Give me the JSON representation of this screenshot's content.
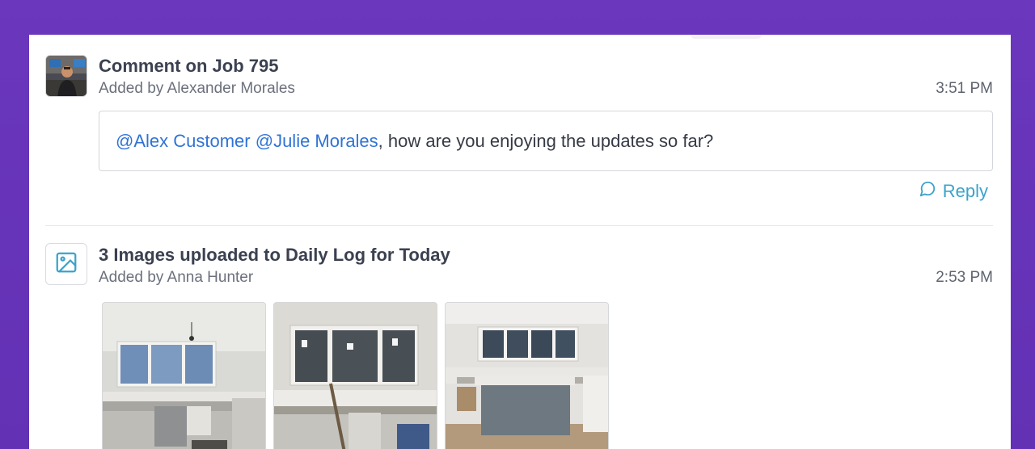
{
  "entries": [
    {
      "title": "Comment on Job 795",
      "added_by": "Added by Alexander Morales",
      "time": "3:51 PM",
      "comment": {
        "mentions": [
          "@Alex Customer",
          "@Julie Morales"
        ],
        "text": ", how are you enjoying the updates so far?"
      },
      "reply_label": "Reply"
    },
    {
      "title": "3 Images uploaded to Daily Log for Today",
      "added_by": "Added by Anna Hunter",
      "time": "2:53 PM",
      "image_count": 3
    }
  ],
  "colors": {
    "background": "#6535b8",
    "mention": "#2f73d6",
    "reply": "#3aa3c9",
    "icon": "#3aa3c9"
  }
}
